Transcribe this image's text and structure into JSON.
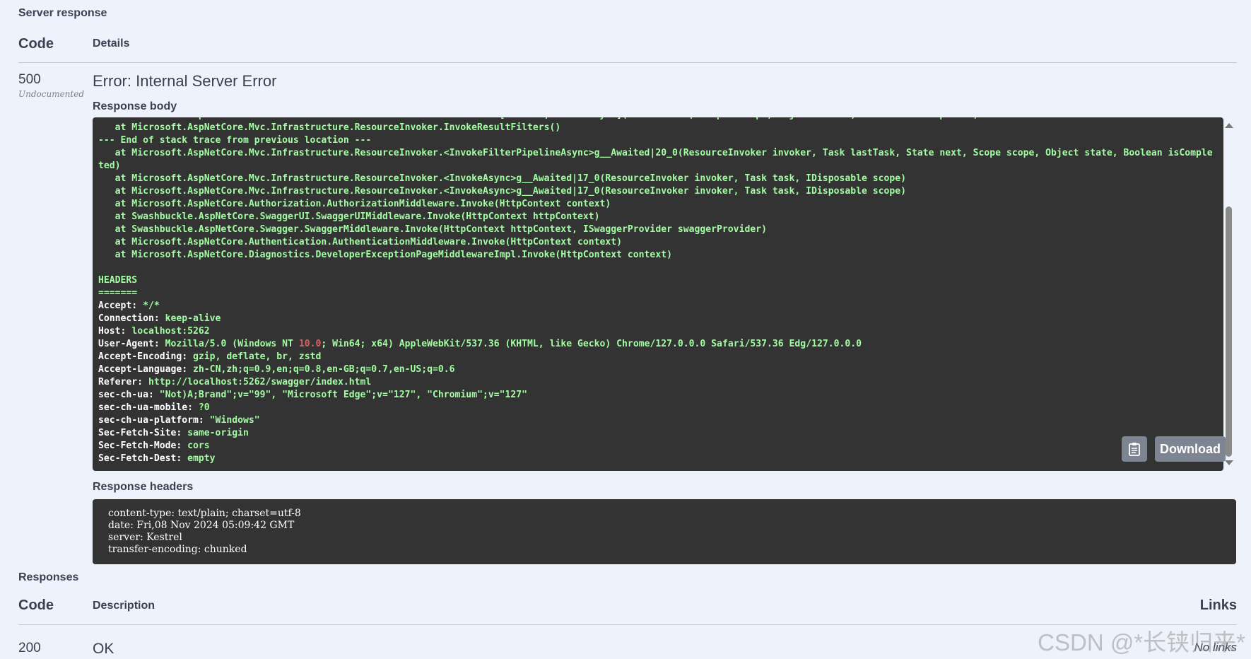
{
  "server_response": {
    "section_title": "Server response",
    "col_code": "Code",
    "col_details": "Details",
    "status_code": "500",
    "status_note": "Undocumented",
    "error_title": "Error: Internal Server Error",
    "response_body_label": "Response body",
    "body_lines": [
      "   at Microsoft.AspNetCore.Mvc.Infrastructure.ResourceInvoker.ResultNext[TFilter,TFilterAsync](State& next, Scope& scope, Object& state, Boolean& isCompleted)",
      "   at Microsoft.AspNetCore.Mvc.Infrastructure.ResourceInvoker.InvokeResultFilters()",
      "--- End of stack trace from previous location ---",
      "   at Microsoft.AspNetCore.Mvc.Infrastructure.ResourceInvoker.<InvokeFilterPipelineAsync>g__Awaited|20_0(ResourceInvoker invoker, Task lastTask, State next, Scope scope, Object state, Boolean isCompleted)",
      "   at Microsoft.AspNetCore.Mvc.Infrastructure.ResourceInvoker.<InvokeAsync>g__Awaited|17_0(ResourceInvoker invoker, Task task, IDisposable scope)",
      "   at Microsoft.AspNetCore.Mvc.Infrastructure.ResourceInvoker.<InvokeAsync>g__Awaited|17_0(ResourceInvoker invoker, Task task, IDisposable scope)",
      "   at Microsoft.AspNetCore.Authorization.AuthorizationMiddleware.Invoke(HttpContext context)",
      "   at Swashbuckle.AspNetCore.SwaggerUI.SwaggerUIMiddleware.Invoke(HttpContext httpContext)",
      "   at Swashbuckle.AspNetCore.Swagger.SwaggerMiddleware.Invoke(HttpContext httpContext, ISwaggerProvider swaggerProvider)",
      "   at Microsoft.AspNetCore.Authentication.AuthenticationMiddleware.Invoke(HttpContext context)",
      "   at Microsoft.AspNetCore.Diagnostics.DeveloperExceptionPageMiddlewareImpl.Invoke(HttpContext context)",
      "",
      "HEADERS",
      "======="
    ],
    "header_pairs": [
      {
        "key": "Accept",
        "value": "*/*"
      },
      {
        "key": "Connection",
        "value": "keep-alive"
      },
      {
        "key": "Host",
        "value": "localhost:5262"
      },
      {
        "key": "User-Agent",
        "value": "Mozilla/5.0 (Windows NT 10.0; Win64; x64) AppleWebKit/537.36 (KHTML, like Gecko) Chrome/127.0.0.0 Safari/537.36 Edg/127.0.0.0"
      },
      {
        "key": "Accept-Encoding",
        "value": "gzip, deflate, br, zstd"
      },
      {
        "key": "Accept-Language",
        "value": "zh-CN,zh;q=0.9,en;q=0.8,en-GB;q=0.7,en-US;q=0.6"
      },
      {
        "key": "Referer",
        "value": "http://localhost:5262/swagger/index.html"
      },
      {
        "key": "sec-ch-ua",
        "value": "\"Not)A;Brand\";v=\"99\", \"Microsoft Edge\";v=\"127\", \"Chromium\";v=\"127\""
      },
      {
        "key": "sec-ch-ua-mobile",
        "value": "?0"
      },
      {
        "key": "sec-ch-ua-platform",
        "value": "\"Windows\""
      },
      {
        "key": "Sec-Fetch-Site",
        "value": "same-origin"
      },
      {
        "key": "Sec-Fetch-Mode",
        "value": "cors"
      },
      {
        "key": "Sec-Fetch-Dest",
        "value": "empty"
      }
    ],
    "download_label": "Download",
    "response_headers_label": "Response headers",
    "response_headers": [
      "content-type: text/plain; charset=utf-8",
      "date: Fri,08 Nov 2024 05:09:42 GMT",
      "server: Kestrel",
      "transfer-encoding: chunked"
    ]
  },
  "responses": {
    "section_title": "Responses",
    "col_code": "Code",
    "col_description": "Description",
    "col_links": "Links",
    "rows": [
      {
        "code": "200",
        "description": "OK",
        "links": "No links"
      }
    ]
  },
  "watermark": "CSDN @*长铗归来*",
  "icons": {
    "copy": "clipboard-icon"
  },
  "colors": {
    "code_bg": "#333333",
    "code_text": "#a2fca2",
    "highlight_number": "#d36363",
    "page_bg": "#eef2fb"
  }
}
